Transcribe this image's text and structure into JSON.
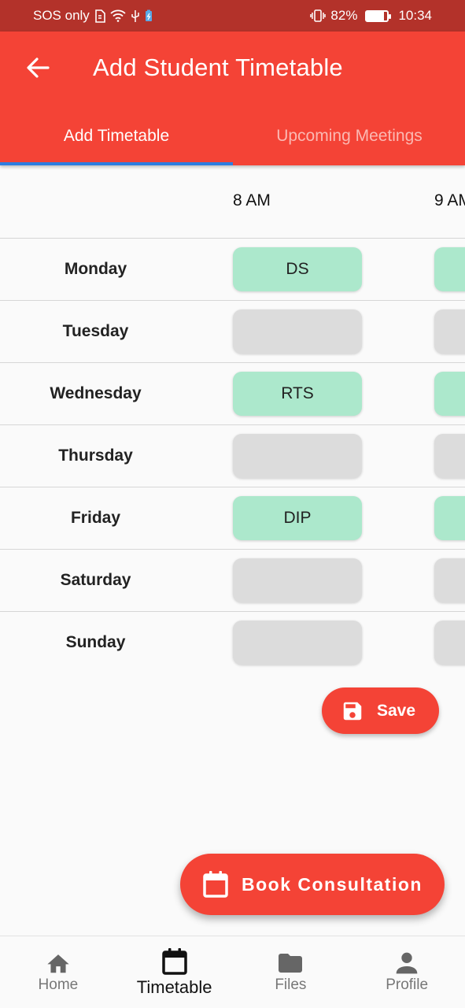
{
  "status_bar": {
    "carrier": "SOS only",
    "battery_percent": "82%",
    "battery_level": 0.82,
    "time": "10:34"
  },
  "app_bar": {
    "title": "Add Student Timetable",
    "tabs": [
      {
        "label": "Add Timetable",
        "active": true
      },
      {
        "label": "Upcoming Meetings",
        "active": false
      }
    ]
  },
  "timetable": {
    "time_headers": [
      "8 AM",
      "9 AM"
    ],
    "rows": [
      {
        "day": "Monday",
        "slots": [
          {
            "text": "DS",
            "filled": true
          },
          {
            "text": "",
            "filled": true
          }
        ]
      },
      {
        "day": "Tuesday",
        "slots": [
          {
            "text": "",
            "filled": false
          },
          {
            "text": "",
            "filled": false
          }
        ]
      },
      {
        "day": "Wednesday",
        "slots": [
          {
            "text": "RTS",
            "filled": true
          },
          {
            "text": "",
            "filled": true
          }
        ]
      },
      {
        "day": "Thursday",
        "slots": [
          {
            "text": "",
            "filled": false
          },
          {
            "text": "",
            "filled": false
          }
        ]
      },
      {
        "day": "Friday",
        "slots": [
          {
            "text": "DIP",
            "filled": true
          },
          {
            "text": "",
            "filled": true
          }
        ]
      },
      {
        "day": "Saturday",
        "slots": [
          {
            "text": "",
            "filled": false
          },
          {
            "text": "",
            "filled": false
          }
        ]
      },
      {
        "day": "Sunday",
        "slots": [
          {
            "text": "",
            "filled": false
          },
          {
            "text": "",
            "filled": false
          }
        ]
      }
    ]
  },
  "actions": {
    "save_label": "Save",
    "book_label": "Book Consultation"
  },
  "bottom_nav": [
    {
      "label": "Home",
      "icon": "home-icon",
      "active": false
    },
    {
      "label": "Timetable",
      "icon": "calendar-icon",
      "active": true
    },
    {
      "label": "Files",
      "icon": "folder-icon",
      "active": false
    },
    {
      "label": "Profile",
      "icon": "person-icon",
      "active": false
    }
  ],
  "colors": {
    "primary": "#f44336",
    "status_bar": "#b3322a",
    "slot_filled": "#ace8cc",
    "slot_empty": "#dcdcdc",
    "tab_indicator": "#2e7de0"
  }
}
